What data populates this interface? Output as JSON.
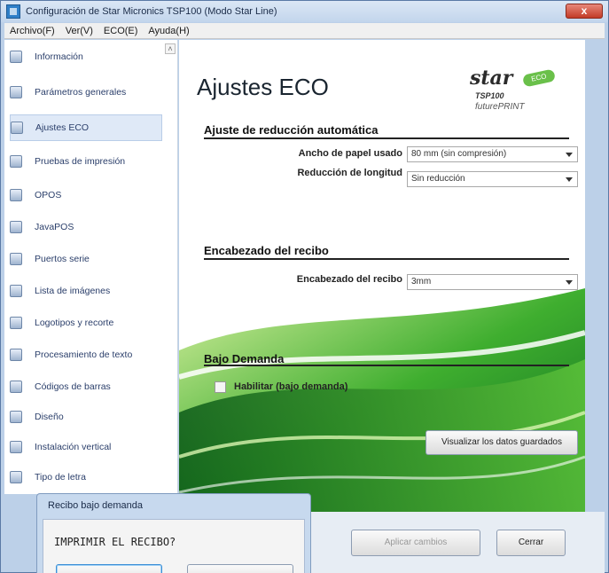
{
  "window": {
    "title": "Configuración de Star Micronics TSP100 (Modo Star Line)",
    "close_label": "x"
  },
  "menubar": [
    "Archivo(F)",
    "Ver(V)",
    "ECO(E)",
    "Ayuda(H)"
  ],
  "sidebar": {
    "items": [
      {
        "label": "Información",
        "icon": "info-icon"
      },
      {
        "label": "Parámetros generales",
        "icon": "settings-icon"
      },
      {
        "label": "Ajustes ECO",
        "icon": "eco-icon",
        "selected": true
      },
      {
        "label": "Pruebas de impresión",
        "icon": "printer-icon"
      },
      {
        "label": "OPOS",
        "icon": "opos-icon"
      },
      {
        "label": "JavaPOS",
        "icon": "javapos-icon"
      },
      {
        "label": "Puertos serie",
        "icon": "serial-port-icon"
      },
      {
        "label": "Lista de imágenes",
        "icon": "image-list-icon"
      },
      {
        "label": "Logotipos y recorte",
        "icon": "logo-icon"
      },
      {
        "label": "Procesamiento de texto",
        "icon": "text-processing-icon"
      },
      {
        "label": "Códigos de barras",
        "icon": "barcode-icon"
      },
      {
        "label": "Diseño",
        "icon": "design-icon"
      },
      {
        "label": "Instalación vertical",
        "icon": "vertical-install-icon"
      },
      {
        "label": "Tipo de letra",
        "icon": "font-icon"
      }
    ]
  },
  "main": {
    "title": "Ajustes ECO",
    "brand": {
      "star": "star",
      "eco": "ECO",
      "model": "TSP100",
      "line": "futurePRINT"
    },
    "sections": {
      "auto_reduction": {
        "title": "Ajuste de reducción automática",
        "paper_width_label": "Ancho de papel usado",
        "paper_width_value": "80 mm (sin compresión)",
        "length_reduction_label": "Reducción de longitud",
        "length_reduction_value": "Sin reducción"
      },
      "receipt_header": {
        "title": "Encabezado del recibo",
        "header_label": "Encabezado del recibo",
        "header_value": "3mm"
      },
      "on_demand": {
        "title": "Bajo Demanda",
        "enable_label": "Habilitar (bajo demanda)",
        "view_saved_label": "Visualizar los datos guardados"
      }
    }
  },
  "footer": {
    "apply_label": "Aplicar cambios",
    "close_label": "Cerrar"
  },
  "dialog": {
    "title": "Recibo bajo demanda",
    "message": "IMPRIMIR EL RECIBO?"
  },
  "colors": {
    "title_bar": "#c2d5ec",
    "selected_item": "#dfe9f7",
    "eco_green": "#6ac04a",
    "close_red": "#c23b27"
  }
}
